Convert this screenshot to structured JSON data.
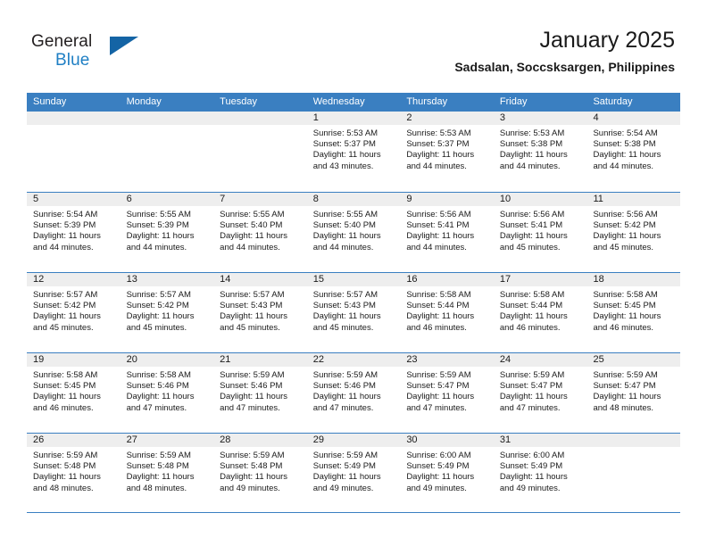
{
  "logo": {
    "primary_text": "General",
    "secondary_text": "Blue",
    "triangle_icon": "triangle-icon",
    "primary_color": "#231f20",
    "secondary_color": "#1f7fc4",
    "triangle_color": "#1464a5"
  },
  "header": {
    "title": "January 2025",
    "subtitle": "Sadsalan, Soccsksargen, Philippines"
  },
  "theme": {
    "header_bar_color": "#3a7fc1",
    "day_number_bg": "#eeeeee",
    "grid_line_color": "#3a7fc1",
    "text_color": "#1a1a1a"
  },
  "weekdays": [
    "Sunday",
    "Monday",
    "Tuesday",
    "Wednesday",
    "Thursday",
    "Friday",
    "Saturday"
  ],
  "labels": {
    "sunrise_prefix": "Sunrise:",
    "sunset_prefix": "Sunset:",
    "daylight_prefix": "Daylight:"
  },
  "weeks": [
    [
      {
        "day": "",
        "empty": true
      },
      {
        "day": "",
        "empty": true
      },
      {
        "day": "",
        "empty": true
      },
      {
        "day": "1",
        "sunrise": "Sunrise: 5:53 AM",
        "sunset": "Sunset: 5:37 PM",
        "daylight": "Daylight: 11 hours and 43 minutes."
      },
      {
        "day": "2",
        "sunrise": "Sunrise: 5:53 AM",
        "sunset": "Sunset: 5:37 PM",
        "daylight": "Daylight: 11 hours and 44 minutes."
      },
      {
        "day": "3",
        "sunrise": "Sunrise: 5:53 AM",
        "sunset": "Sunset: 5:38 PM",
        "daylight": "Daylight: 11 hours and 44 minutes."
      },
      {
        "day": "4",
        "sunrise": "Sunrise: 5:54 AM",
        "sunset": "Sunset: 5:38 PM",
        "daylight": "Daylight: 11 hours and 44 minutes."
      }
    ],
    [
      {
        "day": "5",
        "sunrise": "Sunrise: 5:54 AM",
        "sunset": "Sunset: 5:39 PM",
        "daylight": "Daylight: 11 hours and 44 minutes."
      },
      {
        "day": "6",
        "sunrise": "Sunrise: 5:55 AM",
        "sunset": "Sunset: 5:39 PM",
        "daylight": "Daylight: 11 hours and 44 minutes."
      },
      {
        "day": "7",
        "sunrise": "Sunrise: 5:55 AM",
        "sunset": "Sunset: 5:40 PM",
        "daylight": "Daylight: 11 hours and 44 minutes."
      },
      {
        "day": "8",
        "sunrise": "Sunrise: 5:55 AM",
        "sunset": "Sunset: 5:40 PM",
        "daylight": "Daylight: 11 hours and 44 minutes."
      },
      {
        "day": "9",
        "sunrise": "Sunrise: 5:56 AM",
        "sunset": "Sunset: 5:41 PM",
        "daylight": "Daylight: 11 hours and 44 minutes."
      },
      {
        "day": "10",
        "sunrise": "Sunrise: 5:56 AM",
        "sunset": "Sunset: 5:41 PM",
        "daylight": "Daylight: 11 hours and 45 minutes."
      },
      {
        "day": "11",
        "sunrise": "Sunrise: 5:56 AM",
        "sunset": "Sunset: 5:42 PM",
        "daylight": "Daylight: 11 hours and 45 minutes."
      }
    ],
    [
      {
        "day": "12",
        "sunrise": "Sunrise: 5:57 AM",
        "sunset": "Sunset: 5:42 PM",
        "daylight": "Daylight: 11 hours and 45 minutes."
      },
      {
        "day": "13",
        "sunrise": "Sunrise: 5:57 AM",
        "sunset": "Sunset: 5:42 PM",
        "daylight": "Daylight: 11 hours and 45 minutes."
      },
      {
        "day": "14",
        "sunrise": "Sunrise: 5:57 AM",
        "sunset": "Sunset: 5:43 PM",
        "daylight": "Daylight: 11 hours and 45 minutes."
      },
      {
        "day": "15",
        "sunrise": "Sunrise: 5:57 AM",
        "sunset": "Sunset: 5:43 PM",
        "daylight": "Daylight: 11 hours and 45 minutes."
      },
      {
        "day": "16",
        "sunrise": "Sunrise: 5:58 AM",
        "sunset": "Sunset: 5:44 PM",
        "daylight": "Daylight: 11 hours and 46 minutes."
      },
      {
        "day": "17",
        "sunrise": "Sunrise: 5:58 AM",
        "sunset": "Sunset: 5:44 PM",
        "daylight": "Daylight: 11 hours and 46 minutes."
      },
      {
        "day": "18",
        "sunrise": "Sunrise: 5:58 AM",
        "sunset": "Sunset: 5:45 PM",
        "daylight": "Daylight: 11 hours and 46 minutes."
      }
    ],
    [
      {
        "day": "19",
        "sunrise": "Sunrise: 5:58 AM",
        "sunset": "Sunset: 5:45 PM",
        "daylight": "Daylight: 11 hours and 46 minutes."
      },
      {
        "day": "20",
        "sunrise": "Sunrise: 5:58 AM",
        "sunset": "Sunset: 5:46 PM",
        "daylight": "Daylight: 11 hours and 47 minutes."
      },
      {
        "day": "21",
        "sunrise": "Sunrise: 5:59 AM",
        "sunset": "Sunset: 5:46 PM",
        "daylight": "Daylight: 11 hours and 47 minutes."
      },
      {
        "day": "22",
        "sunrise": "Sunrise: 5:59 AM",
        "sunset": "Sunset: 5:46 PM",
        "daylight": "Daylight: 11 hours and 47 minutes."
      },
      {
        "day": "23",
        "sunrise": "Sunrise: 5:59 AM",
        "sunset": "Sunset: 5:47 PM",
        "daylight": "Daylight: 11 hours and 47 minutes."
      },
      {
        "day": "24",
        "sunrise": "Sunrise: 5:59 AM",
        "sunset": "Sunset: 5:47 PM",
        "daylight": "Daylight: 11 hours and 47 minutes."
      },
      {
        "day": "25",
        "sunrise": "Sunrise: 5:59 AM",
        "sunset": "Sunset: 5:47 PM",
        "daylight": "Daylight: 11 hours and 48 minutes."
      }
    ],
    [
      {
        "day": "26",
        "sunrise": "Sunrise: 5:59 AM",
        "sunset": "Sunset: 5:48 PM",
        "daylight": "Daylight: 11 hours and 48 minutes."
      },
      {
        "day": "27",
        "sunrise": "Sunrise: 5:59 AM",
        "sunset": "Sunset: 5:48 PM",
        "daylight": "Daylight: 11 hours and 48 minutes."
      },
      {
        "day": "28",
        "sunrise": "Sunrise: 5:59 AM",
        "sunset": "Sunset: 5:48 PM",
        "daylight": "Daylight: 11 hours and 49 minutes."
      },
      {
        "day": "29",
        "sunrise": "Sunrise: 5:59 AM",
        "sunset": "Sunset: 5:49 PM",
        "daylight": "Daylight: 11 hours and 49 minutes."
      },
      {
        "day": "30",
        "sunrise": "Sunrise: 6:00 AM",
        "sunset": "Sunset: 5:49 PM",
        "daylight": "Daylight: 11 hours and 49 minutes."
      },
      {
        "day": "31",
        "sunrise": "Sunrise: 6:00 AM",
        "sunset": "Sunset: 5:49 PM",
        "daylight": "Daylight: 11 hours and 49 minutes."
      },
      {
        "day": "",
        "empty": true
      }
    ]
  ]
}
